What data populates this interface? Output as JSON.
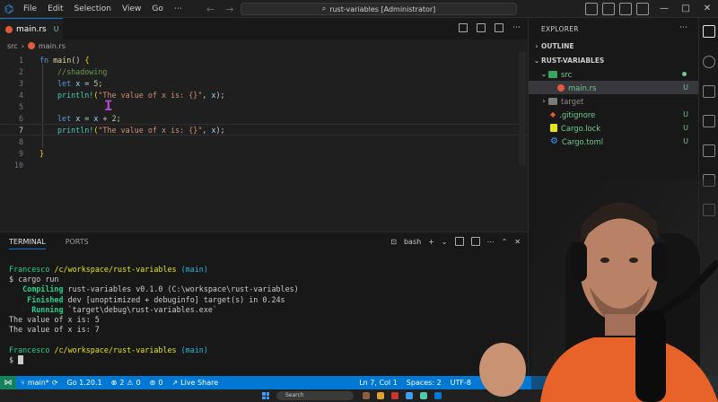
{
  "titlebar": {
    "menu": [
      "File",
      "Edit",
      "Selection",
      "View",
      "Go",
      "⋯"
    ],
    "command_center": "rust-variables [Administrator]",
    "window_buttons": [
      "—",
      "□",
      "✕"
    ]
  },
  "tab": {
    "label": "main.rs",
    "status": "U"
  },
  "breadcrumb": {
    "folder": "src",
    "separator": "›",
    "file": "main.rs"
  },
  "editor": {
    "line_numbers": [
      "1",
      "2",
      "3",
      "4",
      "5",
      "6",
      "7",
      "8",
      "9",
      "10"
    ],
    "lines": {
      "l1_kw": "fn",
      "l1_fn": "main",
      "l1_rest": "() ",
      "l1_brace": "{",
      "l2_comment": "//shadowing",
      "l3_kw": "let",
      "l3_var": "x",
      "l3_eq": " = ",
      "l3_num": "5",
      "l3_semi": ";",
      "l4_mac": "println!",
      "l4_open": "(",
      "l4_str": "\"The value of x is: {}\"",
      "l4_mid": ", ",
      "l4_var": "x",
      "l4_close": ");",
      "l6_kw": "let",
      "l6_var": "x",
      "l6_eq": " = ",
      "l6_var2": "x",
      "l6_op": " + ",
      "l6_num": "2",
      "l6_semi": ";",
      "l7_mac": "println!",
      "l7_open": "(",
      "l7_str": "\"The value of x is: {}\"",
      "l7_mid": ", ",
      "l7_var": "x",
      "l7_close": ");",
      "l9_brace": "}"
    }
  },
  "panel": {
    "tabs": [
      "TERMINAL",
      "PORTS"
    ],
    "shell_label": "bash",
    "terminal": {
      "prompt1_user": "Francesco",
      "prompt1_path": "/c/workspace/rust-variables",
      "prompt1_branch": "(main)",
      "cmd": "$ cargo run",
      "compiling_label": "   Compiling",
      "compiling_text": " rust-variables v0.1.0 (C:\\workspace\\rust-variables)",
      "finished_label": "    Finished",
      "finished_text": " dev [unoptimized + debuginfo] target(s) in 0.24s",
      "running_label": "     Running",
      "running_text": " `target\\debug\\rust-variables.exe`",
      "out1": "The value of x is: 5",
      "out2": "The value of x is: 7",
      "prompt2_user": "Francesco",
      "prompt2_path": "/c/workspace/rust-variables",
      "prompt2_branch": "(main)",
      "prompt2_dollar": "$ "
    }
  },
  "explorer": {
    "header": "EXPLORER",
    "outline": "OUTLINE",
    "project": "RUST-VARIABLES",
    "items": [
      {
        "label": "src",
        "badge": ""
      },
      {
        "label": "main.rs",
        "badge": "U"
      },
      {
        "label": "target",
        "badge": ""
      },
      {
        "label": ".gitignore",
        "badge": "U"
      },
      {
        "label": "Cargo.lock",
        "badge": "U"
      },
      {
        "label": "Cargo.toml",
        "badge": "U"
      }
    ]
  },
  "statusbar": {
    "branch": "main*",
    "go_version": "Go 1.20.1",
    "errors": "2",
    "warnings": "0",
    "ports": "0",
    "live_share": "Live Share",
    "position": "Ln 7, Col 1",
    "spaces": "Spaces: 2",
    "encoding": "UTF-8"
  },
  "taskbar": {
    "search": "Search"
  },
  "colors": {
    "accent": "#0078d4",
    "status_bar": "#0078d4",
    "untracked": "#73c991",
    "rust_icon": "#e5593b"
  }
}
